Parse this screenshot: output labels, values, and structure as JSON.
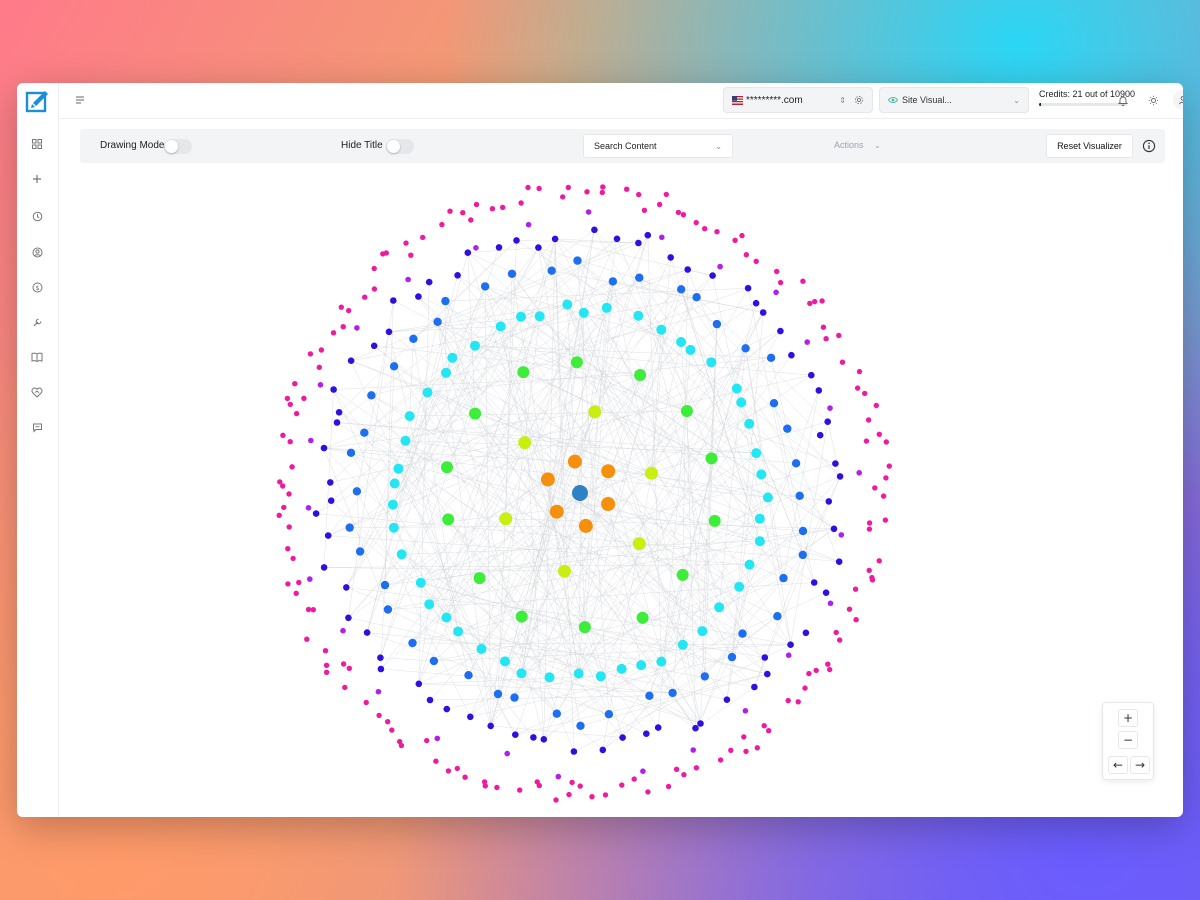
{
  "header": {
    "domain": "*********.com",
    "site_select": "Site Visual...",
    "credits": "Credits: 21 out of 10900",
    "credits_used": 21,
    "credits_total": 10900
  },
  "toolbar": {
    "drawing_mode_label": "Drawing Mode",
    "drawing_mode_on": false,
    "hide_title_label": "Hide Title",
    "hide_title_on": false,
    "search_placeholder": "Search Content",
    "actions_label": "Actions",
    "reset_label": "Reset Visualizer"
  },
  "sidebar": {
    "items": [
      {
        "icon": "dashboard-icon"
      },
      {
        "icon": "plus-icon"
      },
      {
        "icon": "history-icon"
      },
      {
        "icon": "user-circle-icon"
      },
      {
        "icon": "dollar-icon"
      },
      {
        "icon": "wrench-icon"
      },
      {
        "icon": "book-icon"
      },
      {
        "icon": "heart-handshake-icon"
      },
      {
        "icon": "chat-icon"
      }
    ]
  },
  "zoom": {
    "in": "+",
    "out": "−",
    "prev": "←",
    "next": "→"
  },
  "colors": {
    "center": "#2f80c4",
    "level1": "#f5900f",
    "level2": "#c9ee12",
    "level3": "#3ded3a",
    "level4": "#22e6f2",
    "level5": "#1e6ef0",
    "level6": "#3010e0",
    "level7": "#b020e8",
    "level8": "#ee1aa0",
    "edge": "#cfd3d9"
  }
}
